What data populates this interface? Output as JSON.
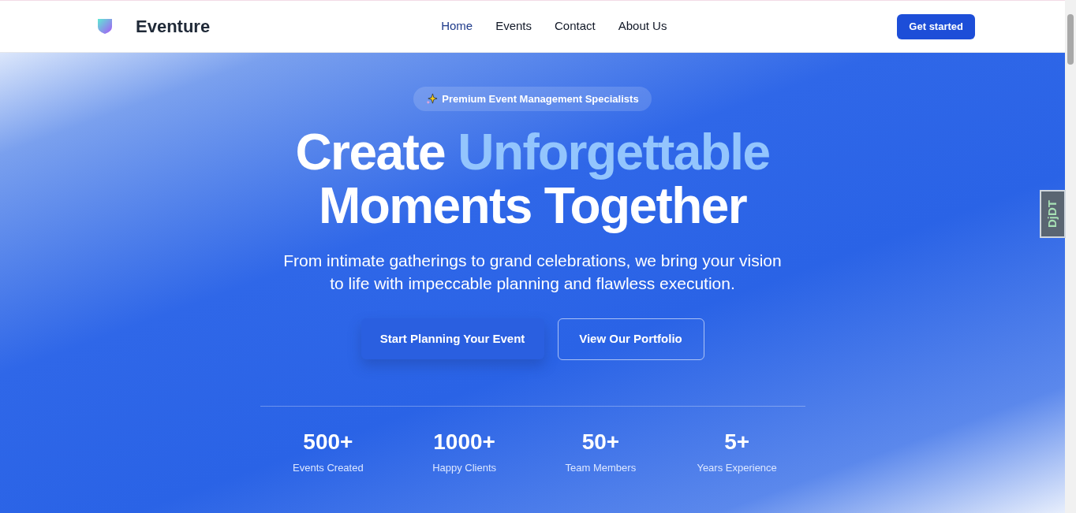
{
  "header": {
    "brand": "Eventure",
    "nav": [
      {
        "label": "Home",
        "selected": true
      },
      {
        "label": "Events",
        "selected": false
      },
      {
        "label": "Contact",
        "selected": false
      },
      {
        "label": "About Us",
        "selected": false
      }
    ],
    "cta": "Get started"
  },
  "hero": {
    "badge": "Premium Event Management Specialists",
    "title_line1": "Create",
    "title_highlight": "Unforgettable",
    "title_line2": "Moments Together",
    "subtitle": "From intimate gatherings to grand celebrations, we bring your vision to life with impeccable planning and flawless execution.",
    "primary_button": "Start Planning Your Event",
    "secondary_button": "View Our Portfolio",
    "stats": [
      {
        "value": "500+",
        "label": "Events Created"
      },
      {
        "value": "1000+",
        "label": "Happy Clients"
      },
      {
        "value": "50+",
        "label": "Team Members"
      },
      {
        "value": "5+",
        "label": "Years Experience"
      }
    ]
  },
  "debug_toolbar": {
    "label": "DjDT"
  }
}
